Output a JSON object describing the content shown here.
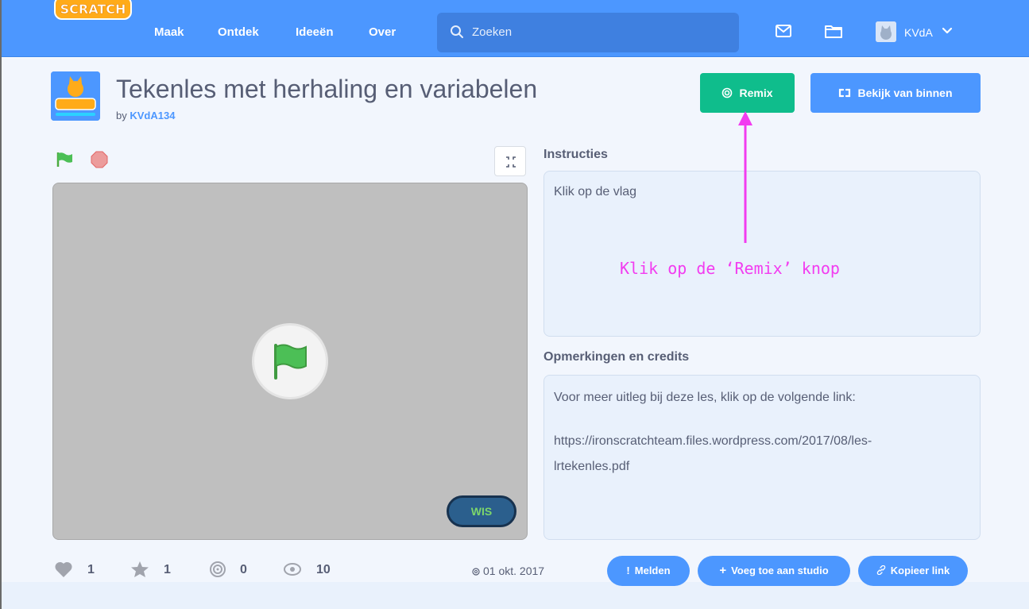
{
  "nav": {
    "logo_text": "SCRATCH",
    "links": [
      "Maak",
      "Ontdek",
      "Ideeën",
      "Over"
    ],
    "search_placeholder": "Zoeken",
    "user": "KVdA",
    "color": "#4c97ff"
  },
  "project": {
    "title": "Tekenles met herhaling en variabelen",
    "by_label": "by",
    "author": "KVdA134",
    "remix_label": "Remix",
    "see_inside_label": "Bekijk van binnen",
    "stage_button_label": "WIS",
    "instructions_heading": "Instructies",
    "instructions_text": "Klik op de vlag",
    "credits_heading": "Opmerkingen en credits",
    "credits_line1": "Voor meer uitleg bij deze les, klik op de volgende link:",
    "credits_line2": "https://ironscratchteam.files.wordpress.com/2017/08/les-",
    "credits_line3": "lrtekenles.pdf"
  },
  "annotation": {
    "text": "Klik op de ‘Remix’ knop",
    "color": "#f23cf0"
  },
  "stats": {
    "loves": "1",
    "favorites": "1",
    "remixes": "0",
    "views": "10",
    "date": "01 okt. 2017",
    "report_label": "Melden",
    "add_studio_label": "Voeg toe aan studio",
    "copy_link_label": "Kopieer link"
  },
  "colors": {
    "remix_green": "#0fbd8c",
    "blue": "#4c97ff",
    "text": "#575e75"
  }
}
